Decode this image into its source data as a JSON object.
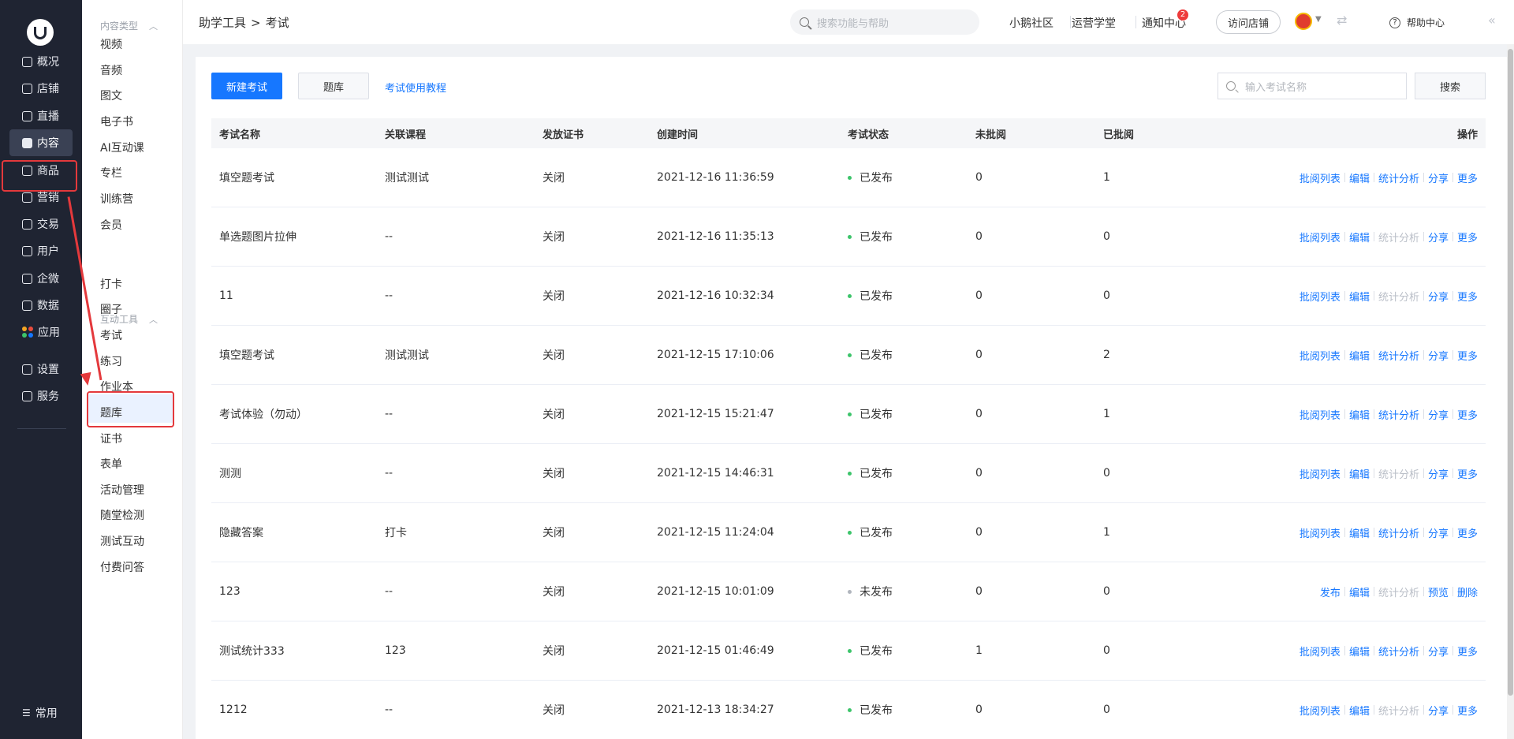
{
  "nav": {
    "items": [
      {
        "label": "概况",
        "icon": "overview-icon"
      },
      {
        "label": "店铺",
        "icon": "store-icon"
      },
      {
        "label": "直播",
        "icon": "live-icon"
      },
      {
        "label": "内容",
        "icon": "content-icon"
      },
      {
        "label": "商品",
        "icon": "goods-icon"
      },
      {
        "label": "营销",
        "icon": "marketing-icon"
      },
      {
        "label": "交易",
        "icon": "trade-icon"
      },
      {
        "label": "用户",
        "icon": "user-icon"
      },
      {
        "label": "企微",
        "icon": "wecom-icon"
      },
      {
        "label": "数据",
        "icon": "data-icon"
      },
      {
        "label": "应用",
        "icon": "apps-icon"
      },
      {
        "label": "设置",
        "icon": "settings-icon"
      },
      {
        "label": "服务",
        "icon": "service-icon"
      }
    ],
    "bottom_label": "常用"
  },
  "submenu": {
    "group1_title": "内容类型",
    "group1_items": [
      "视频",
      "音频",
      "图文",
      "电子书",
      "AI互动课",
      "专栏",
      "训练营",
      "会员"
    ],
    "group2_title": "互动工具",
    "group2_items": [
      "打卡",
      "圈子",
      "考试",
      "练习",
      "作业本",
      "题库",
      "证书",
      "表单",
      "活动管理",
      "随堂检测",
      "测试互动",
      "付费问答"
    ]
  },
  "topbar": {
    "breadcrumb_parent": "助学工具",
    "breadcrumb_sep": ">",
    "breadcrumb_current": "考试",
    "search_placeholder": "搜索功能与帮助",
    "link_community": "小鹅社区",
    "link_academy": "运营学堂",
    "link_notice": "通知中心",
    "notice_badge": "2",
    "visit_store": "访问店铺",
    "help": "帮助中心"
  },
  "toolbar": {
    "new_exam": "新建考试",
    "question_bank": "题库",
    "tutorial_link": "考试使用教程",
    "search_placeholder": "输入考试名称",
    "search_button": "搜索"
  },
  "table": {
    "headers": [
      "考试名称",
      "关联课程",
      "发放证书",
      "创建时间",
      "考试状态",
      "未批阅",
      "已批阅",
      "操作"
    ],
    "rows": [
      {
        "name": "填空题考试",
        "course": "测试测试",
        "cert": "关闭",
        "time": "2021-12-16 11:36:59",
        "status": "已发布",
        "unreviewed": "0",
        "reviewed": "1",
        "ops": [
          "批阅列表",
          "编辑",
          "统计分析",
          "分享",
          "更多"
        ],
        "stats_disabled": false
      },
      {
        "name": "单选题图片拉伸",
        "course": "--",
        "cert": "关闭",
        "time": "2021-12-16 11:35:13",
        "status": "已发布",
        "unreviewed": "0",
        "reviewed": "0",
        "ops": [
          "批阅列表",
          "编辑",
          "统计分析",
          "分享",
          "更多"
        ],
        "stats_disabled": true
      },
      {
        "name": "11",
        "course": "--",
        "cert": "关闭",
        "time": "2021-12-16 10:32:34",
        "status": "已发布",
        "unreviewed": "0",
        "reviewed": "0",
        "ops": [
          "批阅列表",
          "编辑",
          "统计分析",
          "分享",
          "更多"
        ],
        "stats_disabled": true
      },
      {
        "name": "填空题考试",
        "course": "测试测试",
        "cert": "关闭",
        "time": "2021-12-15 17:10:06",
        "status": "已发布",
        "unreviewed": "0",
        "reviewed": "2",
        "ops": [
          "批阅列表",
          "编辑",
          "统计分析",
          "分享",
          "更多"
        ],
        "stats_disabled": false
      },
      {
        "name": "考试体验（勿动）",
        "course": "--",
        "cert": "关闭",
        "time": "2021-12-15 15:21:47",
        "status": "已发布",
        "unreviewed": "0",
        "reviewed": "1",
        "ops": [
          "批阅列表",
          "编辑",
          "统计分析",
          "分享",
          "更多"
        ],
        "stats_disabled": false
      },
      {
        "name": "测测",
        "course": "--",
        "cert": "关闭",
        "time": "2021-12-15 14:46:31",
        "status": "已发布",
        "unreviewed": "0",
        "reviewed": "0",
        "ops": [
          "批阅列表",
          "编辑",
          "统计分析",
          "分享",
          "更多"
        ],
        "stats_disabled": true
      },
      {
        "name": "隐藏答案",
        "course": "打卡",
        "cert": "关闭",
        "time": "2021-12-15 11:24:04",
        "status": "已发布",
        "unreviewed": "0",
        "reviewed": "1",
        "ops": [
          "批阅列表",
          "编辑",
          "统计分析",
          "分享",
          "更多"
        ],
        "stats_disabled": false
      },
      {
        "name": "123",
        "course": "--",
        "cert": "关闭",
        "time": "2021-12-15 10:01:09",
        "status": "未发布",
        "unreviewed": "0",
        "reviewed": "0",
        "ops": [
          "发布",
          "编辑",
          "统计分析",
          "预览",
          "删除"
        ],
        "stats_disabled": true
      },
      {
        "name": "测试统计333",
        "course": "123",
        "cert": "关闭",
        "time": "2021-12-15 01:46:49",
        "status": "已发布",
        "unreviewed": "1",
        "reviewed": "0",
        "ops": [
          "批阅列表",
          "编辑",
          "统计分析",
          "分享",
          "更多"
        ],
        "stats_disabled": false
      },
      {
        "name": "1212",
        "course": "--",
        "cert": "关闭",
        "time": "2021-12-13 18:34:27",
        "status": "已发布",
        "unreviewed": "0",
        "reviewed": "0",
        "ops": [
          "批阅列表",
          "编辑",
          "统计分析",
          "分享",
          "更多"
        ],
        "stats_disabled": true
      }
    ]
  },
  "colors": {
    "primary": "#1677ff",
    "published_dot": "#3cc46a",
    "unpublished_dot": "#b0b5bd",
    "annotation": "#e4393c",
    "nav_bg": "#1f2432"
  }
}
